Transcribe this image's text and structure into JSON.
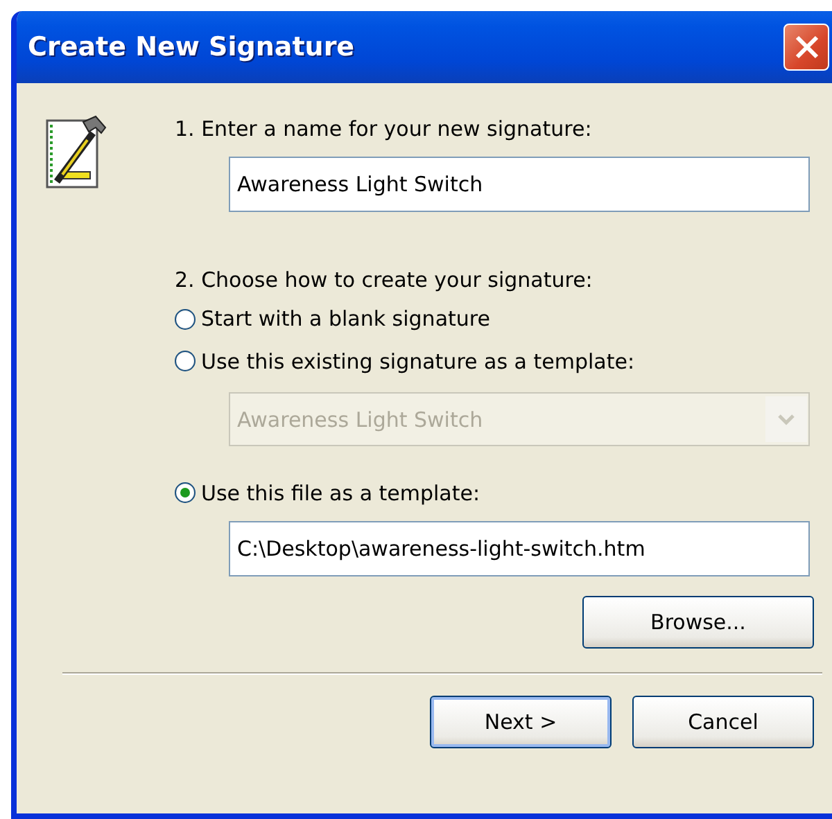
{
  "window": {
    "title": "Create New Signature"
  },
  "name_field": {
    "label": "1. Enter a name for your new signature:",
    "value": "Awareness Light Switch"
  },
  "method": {
    "label": "2. Choose how to create your signature:",
    "options": [
      {
        "label": "Start with a blank signature",
        "selected": false
      },
      {
        "label": "Use this existing signature as a template:",
        "selected": false
      },
      {
        "label": "Use this file as a template:",
        "selected": true
      }
    ]
  },
  "template_dropdown": {
    "value": "Awareness Light Switch",
    "disabled": true
  },
  "file_field": {
    "value": "C:\\Desktop\\awareness-light-switch.htm"
  },
  "browse_button": {
    "label": "Browse..."
  },
  "footer_buttons": [
    {
      "label": "Next >",
      "default": true
    },
    {
      "label": "Cancel",
      "default": false
    }
  ]
}
